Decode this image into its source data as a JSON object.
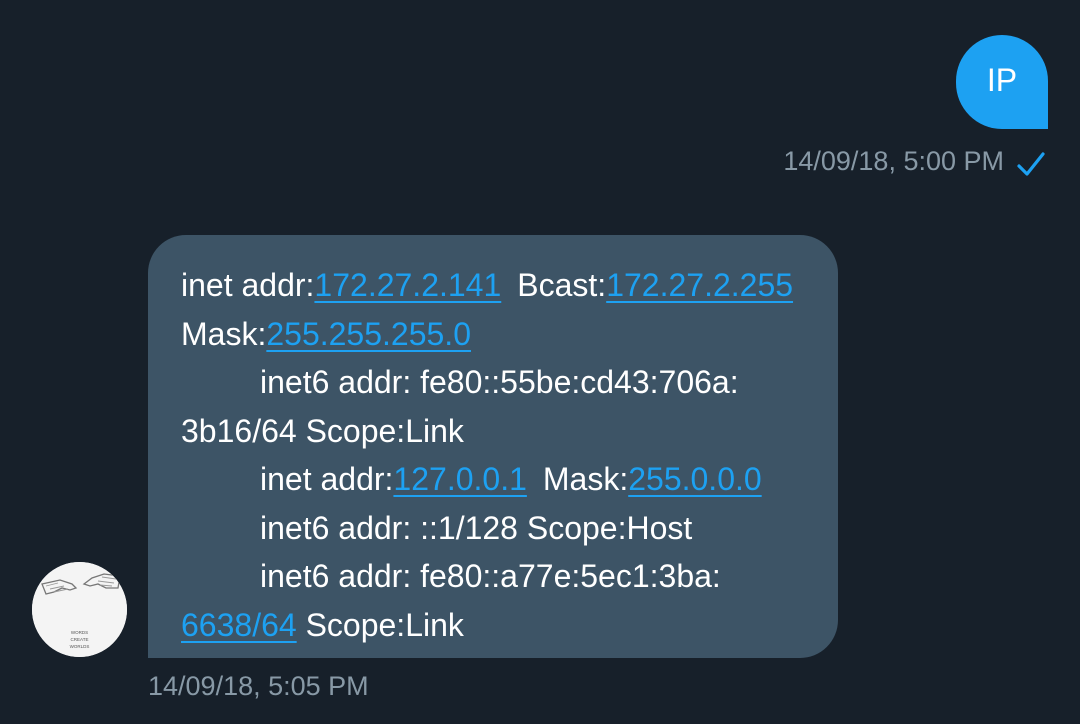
{
  "outgoing": {
    "text": "IP",
    "timestamp": "14/09/18, 5:00 PM",
    "status_icon": "check-icon",
    "bubble_color": "#1da1f2"
  },
  "incoming": {
    "bubble_color": "#3d5466",
    "link_color": "#1da1f2",
    "timestamp": "14/09/18, 5:05 PM",
    "avatar_icon": "avatar-image",
    "avatar_caption": [
      "WORDS",
      "CREATE",
      "WORLDS"
    ],
    "lines": [
      {
        "t1": "inet addr:",
        "l1": "172.27.2.141",
        "t2": "Bcast:",
        "l2": "172.27.2.255"
      },
      {
        "t1": "Mask:",
        "l1": "255.255.255.0"
      },
      {
        "t1": "inet6 addr: fe80::55be:cd43:706a:"
      },
      {
        "t1": "3b16/64 Scope:Link"
      },
      {
        "t1": "inet addr:",
        "l1": "127.0.0.1",
        "t2": "Mask:",
        "l2": "255.0.0.0"
      },
      {
        "t1": "inet6 addr: ::1/128 Scope:Host"
      },
      {
        "t1": "inet6 addr: fe80::a77e:5ec1:3ba:"
      },
      {
        "l1": "6638/64",
        "t2": " Scope:Link"
      }
    ]
  }
}
